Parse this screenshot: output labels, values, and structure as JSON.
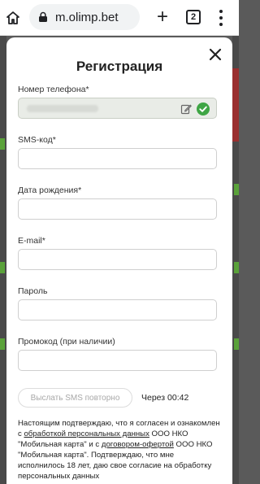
{
  "browser": {
    "url": "m.olimp.bet",
    "tab_count": "2",
    "plus_glyph": "+"
  },
  "modal": {
    "title": "Регистрация",
    "fields": [
      {
        "label": "Номер телефона*",
        "value": ""
      },
      {
        "label": "SMS-код*",
        "value": ""
      },
      {
        "label": "Дата рождения*",
        "value": ""
      },
      {
        "label": "E-mail*",
        "value": ""
      },
      {
        "label": "Пароль",
        "value": ""
      },
      {
        "label": "Промокод (при наличии)",
        "value": ""
      }
    ],
    "resend_button": "Выслать SMS повторно",
    "timer": "Через 00:42",
    "consent": {
      "part1": "Настоящим подтверждаю, что я согласен и ознакомлен с ",
      "link1": "обработкой персональных данных",
      "part2": " ООО НКО \"Мобильная карта\" и с ",
      "link2": "договором-офертой",
      "part3": " ООО НКО \"Мобильная карта\". Подтверждаю, что мне исполнилось 18 лет, даю свое согласие на обработку персональных данных"
    }
  },
  "colors": {
    "accent_green": "#3ea544",
    "filled_field_bg": "#e9ece7"
  }
}
